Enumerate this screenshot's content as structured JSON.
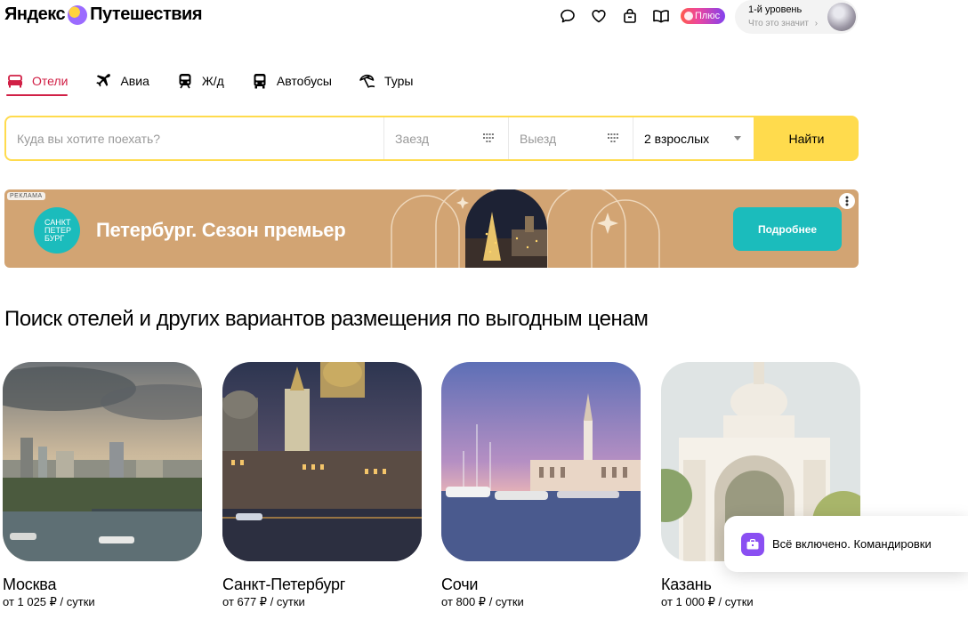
{
  "header": {
    "logo_part1": "Яндекс",
    "logo_part2": "Путешествия",
    "icons": [
      "chat-icon",
      "heart-icon",
      "bag-icon",
      "book-icon"
    ],
    "plus_label": "Плюс",
    "level_title": "1-й уровень",
    "level_sub": "Что это значит",
    "level_chevron": "›"
  },
  "tabs": [
    {
      "label": "Отели",
      "icon": "bed-icon",
      "active": true
    },
    {
      "label": "Авиа",
      "icon": "plane-icon",
      "active": false
    },
    {
      "label": "Ж/д",
      "icon": "train-icon",
      "active": false
    },
    {
      "label": "Автобусы",
      "icon": "bus-icon",
      "active": false
    },
    {
      "label": "Туры",
      "icon": "beach-umbrella-icon",
      "active": false
    }
  ],
  "search": {
    "destination_placeholder": "Куда вы хотите поехать?",
    "checkin_placeholder": "Заезд",
    "checkout_placeholder": "Выезд",
    "guests_value": "2 взрослых",
    "find_label": "Найти"
  },
  "banner": {
    "ad_label": "РЕКЛАМА",
    "logo_text": "САНКТ ПЕТЕР БУРГ",
    "title": "Петербург. Сезон премьер",
    "button_label": "Подробнее",
    "bg_color": "#d2a473",
    "accent_color": "#1bbcbc"
  },
  "main": {
    "title": "Поиск отелей и других вариантов размещения по выгодным ценам"
  },
  "cities": [
    {
      "name": "Москва",
      "price": "от 1 025 ₽ / сутки"
    },
    {
      "name": "Санкт-Петербург",
      "price": "от 677 ₽ / сутки"
    },
    {
      "name": "Сочи",
      "price": "от 800 ₽ / сутки"
    },
    {
      "name": "Казань",
      "price": "от 1 000 ₽ / сутки"
    }
  ],
  "popup": {
    "text": "Всё включено. Командировки",
    "icon": "briefcase-icon"
  },
  "colors": {
    "accent": "#d12046",
    "search_border": "#ffdb4d",
    "popup_icon": "#8a4ff2"
  }
}
